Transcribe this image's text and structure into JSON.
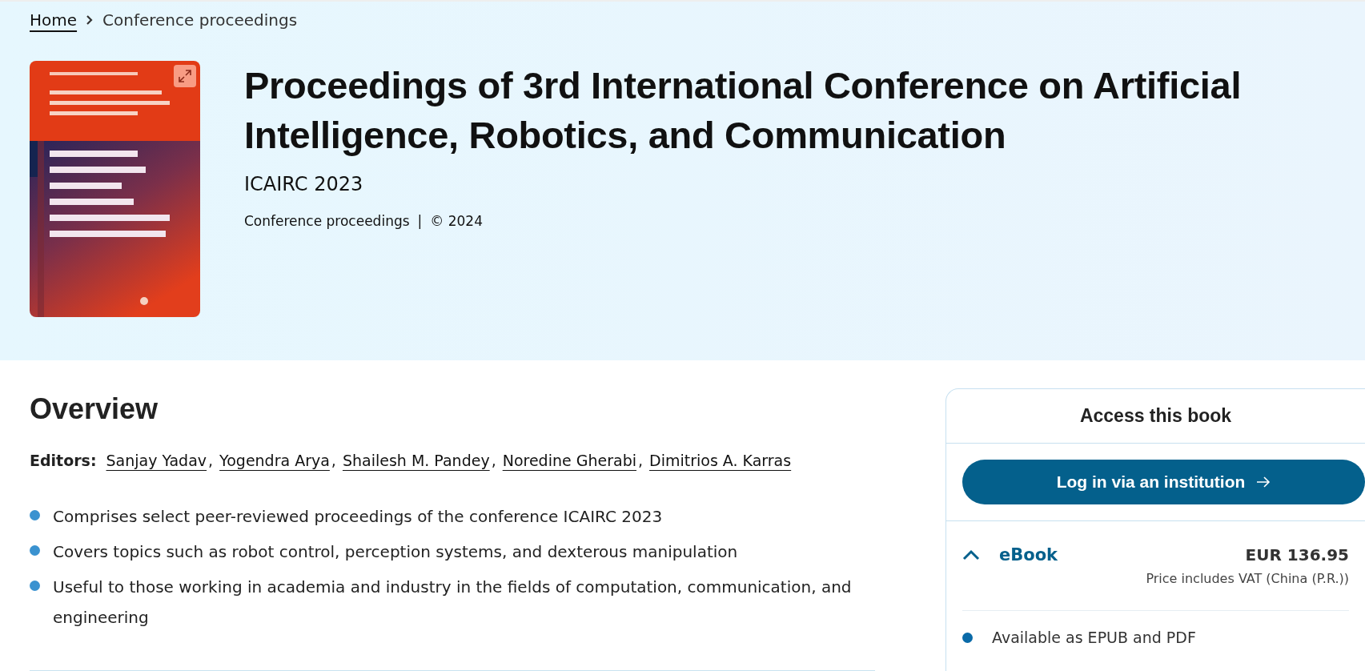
{
  "breadcrumb": [
    {
      "label": "Home",
      "kind": "link"
    },
    {
      "label": "Conference proceedings",
      "kind": "current"
    }
  ],
  "book": {
    "cover": {
      "kind": "picture"
    },
    "title": "Proceedings of 3rd International Conference on Artificial Intelligence, Robotics, and Communication",
    "subtitle": "ICAIRC 2023",
    "meta": [
      "Conference proceedings",
      "© 2024"
    ],
    "meta_separator": "|"
  },
  "overview": {
    "heading": "Overview",
    "editors_label": "Editors:",
    "editor_separator": ",",
    "editors": [
      "Sanjay Yadav",
      "Yogendra Arya",
      "Shailesh M. Pandey",
      "Noredine Gherabi",
      "Dimitrios A. Karras"
    ],
    "bullets": [
      "Comprises select peer-reviewed proceedings of the conference ICAIRC 2023",
      "Covers topics such as robot control, perception systems, and dexterous manipulation",
      "Useful to those working in academia and industry in the fields of computation, communication, and engineering"
    ]
  },
  "access": {
    "heading": "Access this book",
    "login_button": "Log in via an institution",
    "options": [
      {
        "label": "eBook",
        "expanded": true,
        "price": "EUR 136.95",
        "note": "Price includes VAT (China (P.R.))",
        "features": [
          "Available as EPUB and PDF"
        ]
      }
    ]
  }
}
